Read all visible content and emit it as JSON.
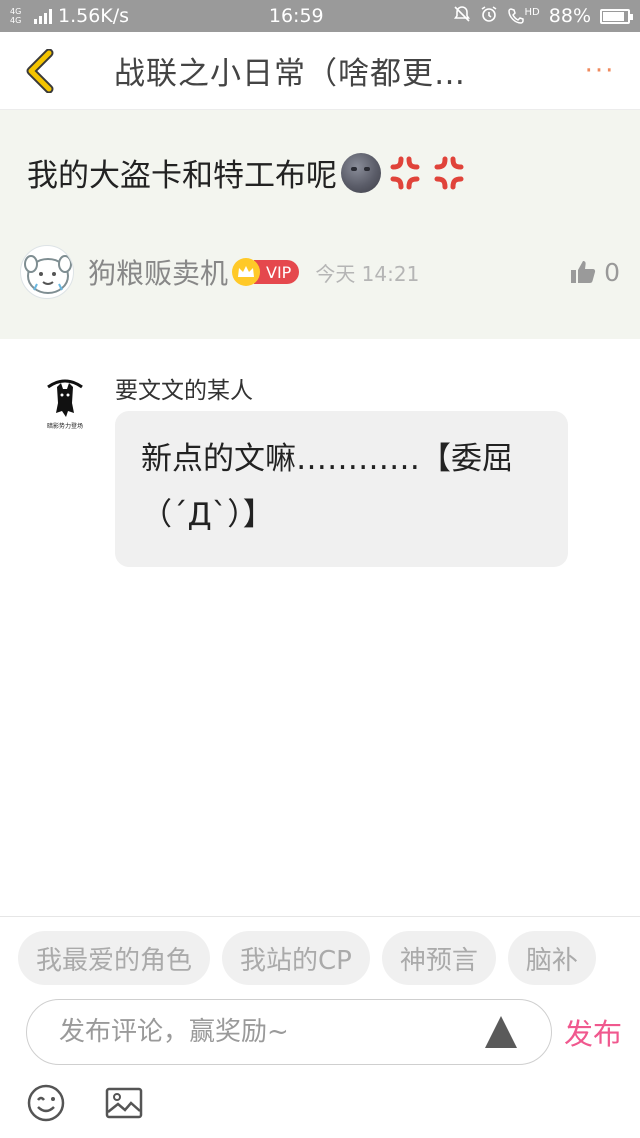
{
  "status_bar": {
    "network_type": "4G 4G",
    "speed": "1.56K/s",
    "time": "16:59",
    "hd": "HD",
    "battery_percent": "88%",
    "battery_level": 0.88
  },
  "header": {
    "title": "战联之小日常（啥都更…",
    "more": "···"
  },
  "post": {
    "title": "我的大盗卡和特工布呢",
    "author": "狗粮贩卖机",
    "vip": "VIP",
    "time": "今天 14:21",
    "likes": "0"
  },
  "comment": {
    "user": "要文文的某人",
    "avatar_caption": "暗影势力登场",
    "text_line1": "新点的文嘛…………【委屈",
    "text_line2": "（´Д`）】"
  },
  "tags": [
    "我最爱的角色",
    "我站的CP",
    "神预言",
    "脑补"
  ],
  "composer": {
    "placeholder": "发布评论，赢奖励~",
    "publish": "发布"
  },
  "colors": {
    "accent_pink": "#f0588e",
    "accent_orange": "#f08a5d",
    "back_yellow": "#f4c400",
    "post_bg": "#f3f5ef"
  }
}
